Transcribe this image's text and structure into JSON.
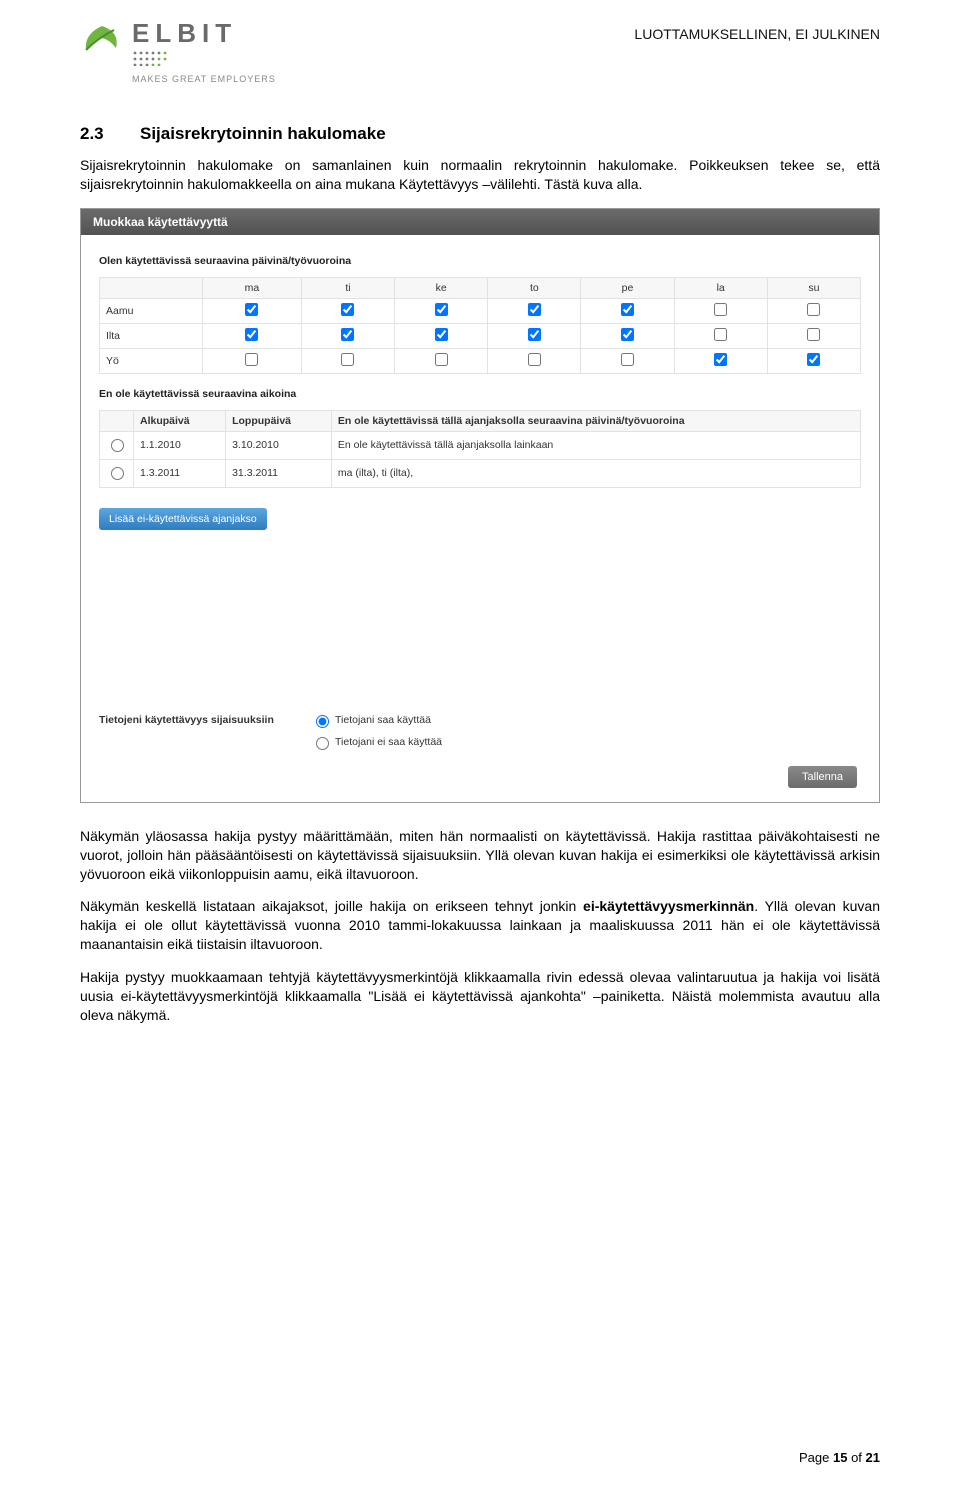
{
  "brand": {
    "name": "ELBIT",
    "tagline": "MAKES GREAT EMPLOYERS"
  },
  "confidential": "LUOTTAMUKSELLINEN, EI JULKINEN",
  "section": {
    "num": "2.3",
    "title": "Sijaisrekrytoinnin hakulomake"
  },
  "p1": "Sijaisrekrytoinnin hakulomake on samanlainen kuin normaalin rekrytoinnin hakulomake. Poikkeuksen tekee se, että sijaisrekrytoinnin hakulomakkeella on aina mukana Käytettävyys –välilehti. Tästä kuva alla.",
  "ss": {
    "header": "Muokkaa käytettävyyttä",
    "avail_title": "Olen käytettävissä seuraavina päivinä/työvuoroina",
    "days": [
      "ma",
      "ti",
      "ke",
      "to",
      "pe",
      "la",
      "su"
    ],
    "rows": [
      {
        "label": "Aamu",
        "vals": [
          true,
          true,
          true,
          true,
          true,
          false,
          false
        ]
      },
      {
        "label": "Ilta",
        "vals": [
          true,
          true,
          true,
          true,
          true,
          false,
          false
        ]
      },
      {
        "label": "Yö",
        "vals": [
          false,
          false,
          false,
          false,
          false,
          true,
          true
        ]
      }
    ],
    "unavail_title": "En ole käytettävissä seuraavina aikoina",
    "un_headers": [
      "Alkupäivä",
      "Loppupäivä",
      "En ole käytettävissä tällä ajanjaksolla seuraavina päivinä/työvuoroina"
    ],
    "un_rows": [
      {
        "start": "1.1.2010",
        "end": "3.10.2010",
        "note": "En ole käytettävissä tällä ajanjaksolla lainkaan"
      },
      {
        "start": "1.3.2011",
        "end": "31.3.2011",
        "note": "ma (ilta), ti (ilta),"
      }
    ],
    "add_btn": "Lisää ei-käytettävissä ajanjakso",
    "perm_label": "Tietojeni käytettävyys sijaisuuksiin",
    "perm_opt1": "Tietojani saa käyttää",
    "perm_opt2": "Tietojani ei saa käyttää",
    "save_btn": "Tallenna"
  },
  "p2a": "Näkymän yläosassa hakija pystyy määrittämään, miten hän normaalisti on käytettävissä. Hakija rastittaa päiväkohtaisesti ne vuorot, jolloin hän pääsääntöisesti on käytettävissä sijaisuuksiin. Yllä olevan kuvan hakija ei esimerkiksi ole käytettävissä arkisin yövuoroon eikä viikonloppuisin aamu, eikä iltavuoroon.",
  "p3_pre": "Näkymän keskellä listataan aikajaksot, joille hakija on erikseen tehnyt jonkin ",
  "p3_bold": "ei-käytettävyysmerkinnän",
  "p3_post": ". Yllä olevan kuvan hakija ei ole ollut käytettävissä vuonna 2010 tammi-lokakuussa lainkaan ja maaliskuussa 2011 hän ei ole käytettävissä maanantaisin eikä tiistaisin iltavuoroon.",
  "p4": "Hakija pystyy muokkaamaan tehtyjä käytettävyysmerkintöjä klikkaamalla rivin edessä olevaa valintaruutua ja hakija voi lisätä uusia ei-käytettävyysmerkintöjä klikkaamalla \"Lisää ei käytettävissä ajankohta\" –painiketta. Näistä molemmista avautuu alla oleva näkymä.",
  "footer": {
    "pre": "Page ",
    "cur": "15",
    "mid": " of ",
    "tot": "21"
  }
}
